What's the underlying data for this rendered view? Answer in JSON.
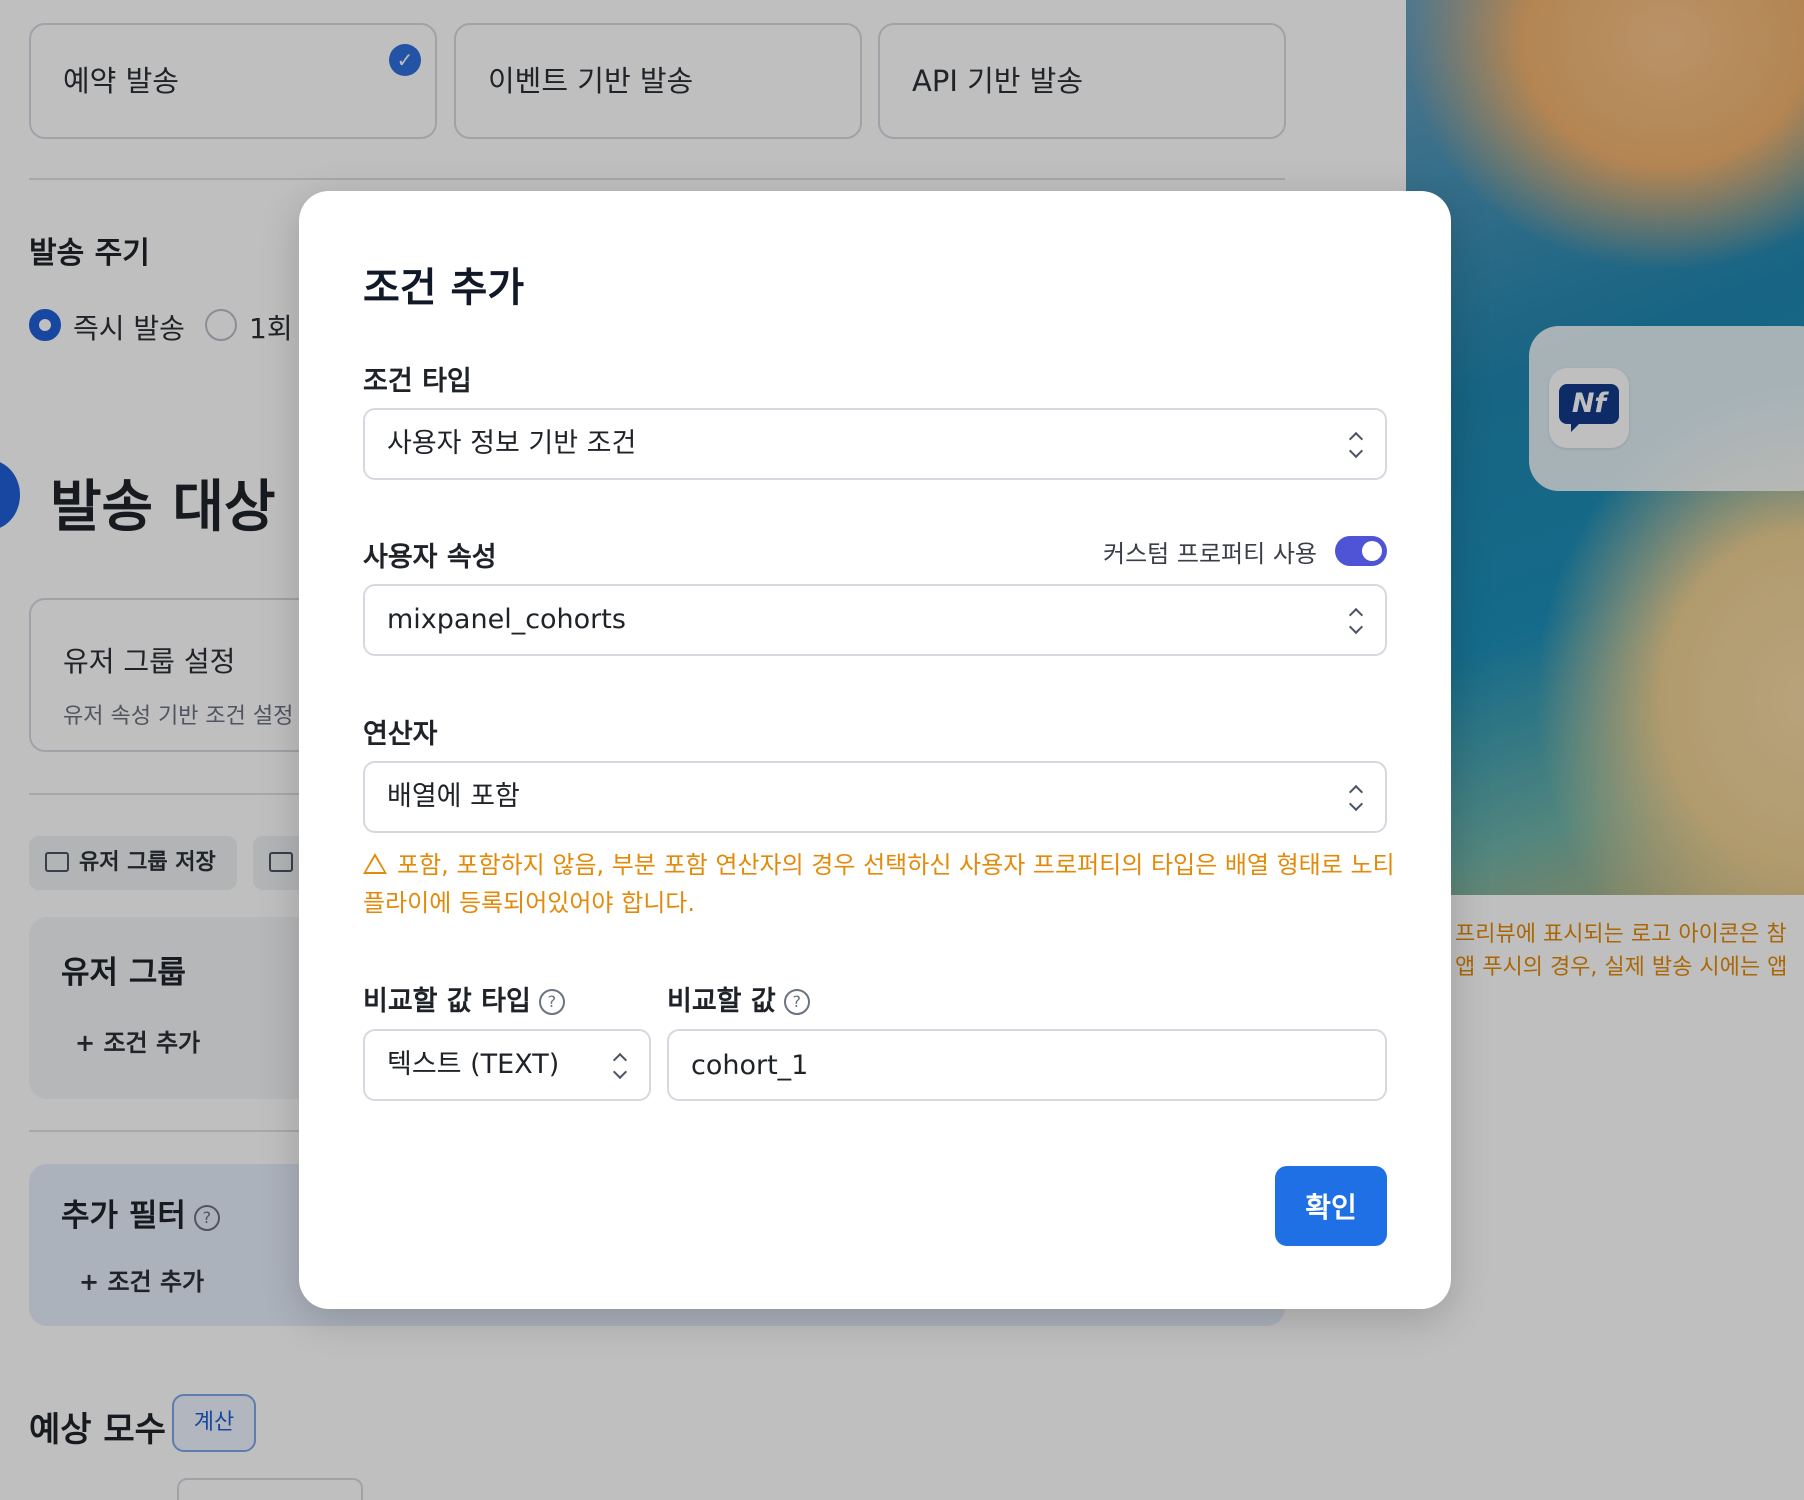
{
  "background": {
    "send_types": [
      {
        "label": "예약 발송",
        "selected": true
      },
      {
        "label": "이벤트 기반 발송",
        "selected": false
      },
      {
        "label": "API 기반 발송",
        "selected": false
      }
    ],
    "cycle_title": "발송 주기",
    "cycle_options": [
      {
        "label": "즉시 발송",
        "selected": true
      },
      {
        "label": "1회 (",
        "selected": false
      }
    ],
    "target_title": "발송 대상",
    "group_card": {
      "title": "유저 그룹 설정",
      "subtitle": "유저 속성 기반 조건 설정"
    },
    "save_group_label": "유저 그룹 저장",
    "user_group": {
      "title": "유저 그룹",
      "add_condition": "+ 조건 추가"
    },
    "extra_filter": {
      "title": "추가 필터",
      "add_condition": "+ 조건 추가"
    },
    "estimate": {
      "title": "예상 모수",
      "calc_label": "계산"
    },
    "preview_note": [
      "프리뷰에 표시되는 로고 아이콘은 참",
      "앱 푸시의 경우, 실제 발송 시에는 앱"
    ],
    "app_icon_text": "Nf"
  },
  "modal": {
    "title": "조건 추가",
    "condition_type": {
      "label": "조건 타입",
      "value": "사용자 정보 기반 조건"
    },
    "user_attribute": {
      "label": "사용자 속성",
      "value": "mixpanel_cohorts",
      "toggle_label": "커스텀 프로퍼티 사용",
      "toggle_on": true
    },
    "operator": {
      "label": "연산자",
      "value": "배열에 포함"
    },
    "warning": "포함, 포함하지 않음, 부분 포함 연산자의 경우 선택하신 사용자 프로퍼티의 타입은 배열 형태로 노티플라이에 등록되어있어야 합니다.",
    "compare_type": {
      "label": "비교할 값 타입",
      "value": "텍스트 (TEXT)"
    },
    "compare_value": {
      "label": "비교할 값",
      "value": "cohort_1"
    },
    "confirm_label": "확인"
  },
  "colors": {
    "accent": "#1f6fe5",
    "toggle": "#4f53d6",
    "warning": "#e38a0a"
  }
}
